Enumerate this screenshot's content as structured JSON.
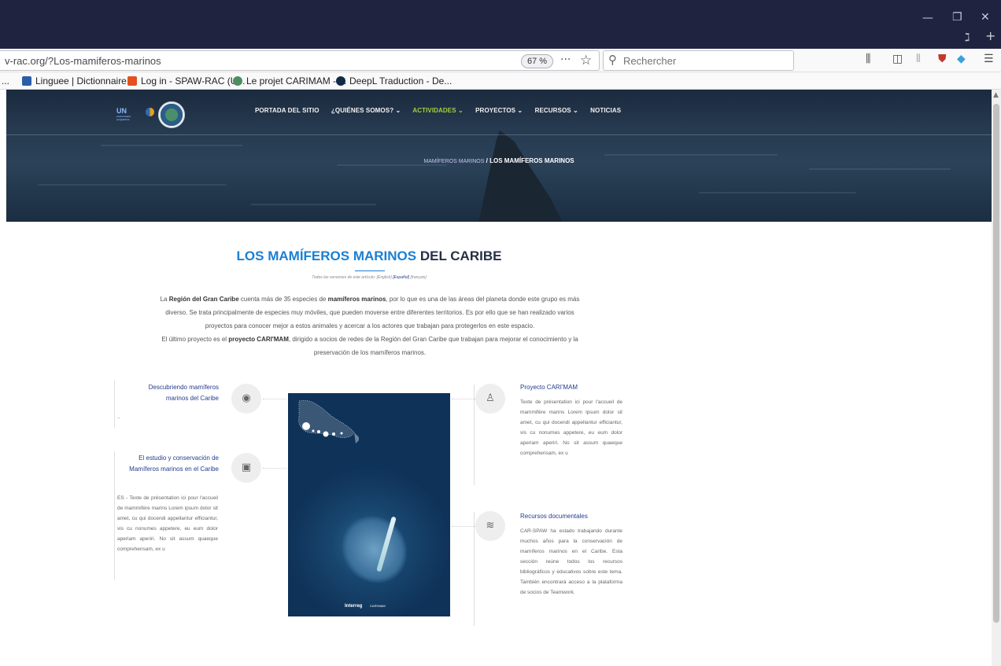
{
  "browser": {
    "url": "v-rac.org/?Los-mamiferos-marinos",
    "zoom": "67 %",
    "search_placeholder": "Rechercher",
    "page_actions": "···",
    "bookmarks": [
      {
        "label": "...",
        "color": "#888888"
      },
      {
        "label": "Linguee | Dictionnaire ...",
        "color": "#2a5ea8"
      },
      {
        "label": "Log in - SPAW-RAC (U...",
        "color": "#e4501f"
      },
      {
        "label": "Le projet CARIMAM - ...",
        "color": "#4e8d62"
      },
      {
        "label": "DeepL Traduction - De...",
        "color": "#0f2b46"
      }
    ]
  },
  "site": {
    "logo_un": "UN",
    "logo_un_sub": "environment programme",
    "nav": [
      {
        "label": "PORTADA DEL SITIO",
        "active": false
      },
      {
        "label": "¿QUIÉNES SOMOS? ⌄",
        "active": false
      },
      {
        "label": "ACTIVIDADES ⌄",
        "active": true
      },
      {
        "label": "PROYECTOS ⌄",
        "active": false
      },
      {
        "label": "RECURSOS ⌄",
        "active": false
      },
      {
        "label": "NOTICIAS",
        "active": false
      }
    ],
    "breadcrumb": {
      "parent": "MAMÍFEROS MARINOS",
      "sep": "/",
      "current": "LOS MAMÍFEROS MARINOS"
    }
  },
  "article": {
    "title_accent": "LOS MAMÍFEROS MARINOS",
    "title_rest": "DEL CARIBE",
    "versions_prefix": "Todas las versiones de este artículo:",
    "versions": [
      "[English]",
      "[Español]",
      "[français]"
    ],
    "intro": {
      "p1_a": "La ",
      "p1_b": "Región del Gran Caribe",
      "p1_c": " cuenta más de 35 especies de ",
      "p1_d": "mamíferos marinos",
      "p1_e": ", por lo que es una de las áreas del planeta donde este grupo es más",
      "line2": "diverso. Se trata principalmente de especies muy móviles, que pueden moverse entre diferentes territorios. Es por ello que se han realizado varios",
      "line3": "proyectos para conocer mejor a estos animales y acercar a los actores que trabajan para protegerlos en este espacio.",
      "p2_a": "El último proyecto es el ",
      "p2_b": "proyecto CARI'MAM",
      "p2_c": ", dirigido a socios de redes de la Región del Gran Caribe que trabajan para mejorar el conocimiento y la",
      "line5": "preservación de los mamíferos marinos."
    },
    "sections": {
      "descubriendo": {
        "title": "Descubriendo mamíferos marinos del Caribe",
        "body": "..",
        "icon": "eye-icon"
      },
      "estudio": {
        "title": "El estudio y conservación de Mamíferos marinos en el Caribe",
        "body": "ES - Texte de présentation ici pour l'accueil de mammifère marins Lorem ipsum dolor sit amet, cu qui docendi appellantur efficiantur, vis cu nonumes appetere, eu eum dolor aperiam aperiri. No sit assum quaeque comprehensam, ex u",
        "icon": "presentation-icon"
      },
      "carimam": {
        "title": "Proyecto CARI'MAM",
        "body": "Texte de présentation ici pour l'accueil de mammifère marins Lorem ipsum dolor sit amet, cu qui docendi appellantur efficiantur, vis cu nonumes appetere, eu eum dolor aperiam aperiri. No sit assum quaeque comprehensam, ex u",
        "icon": "team-icon"
      },
      "recursos": {
        "title": "Recursos documentales",
        "body": "CAR-SPAW ha estado trabajando durante muchos años para la conservación de mamíferos marinos en el Caribe. Esta sección reúne todos los recursos bibliográficos y educativos sobre este tema. También encontrará acceso a la plataforma de socios de Teamwork.",
        "icon": "layers-icon"
      }
    },
    "poster": {
      "brand": "Interreg",
      "brand_small": "CARI'MAM"
    }
  }
}
